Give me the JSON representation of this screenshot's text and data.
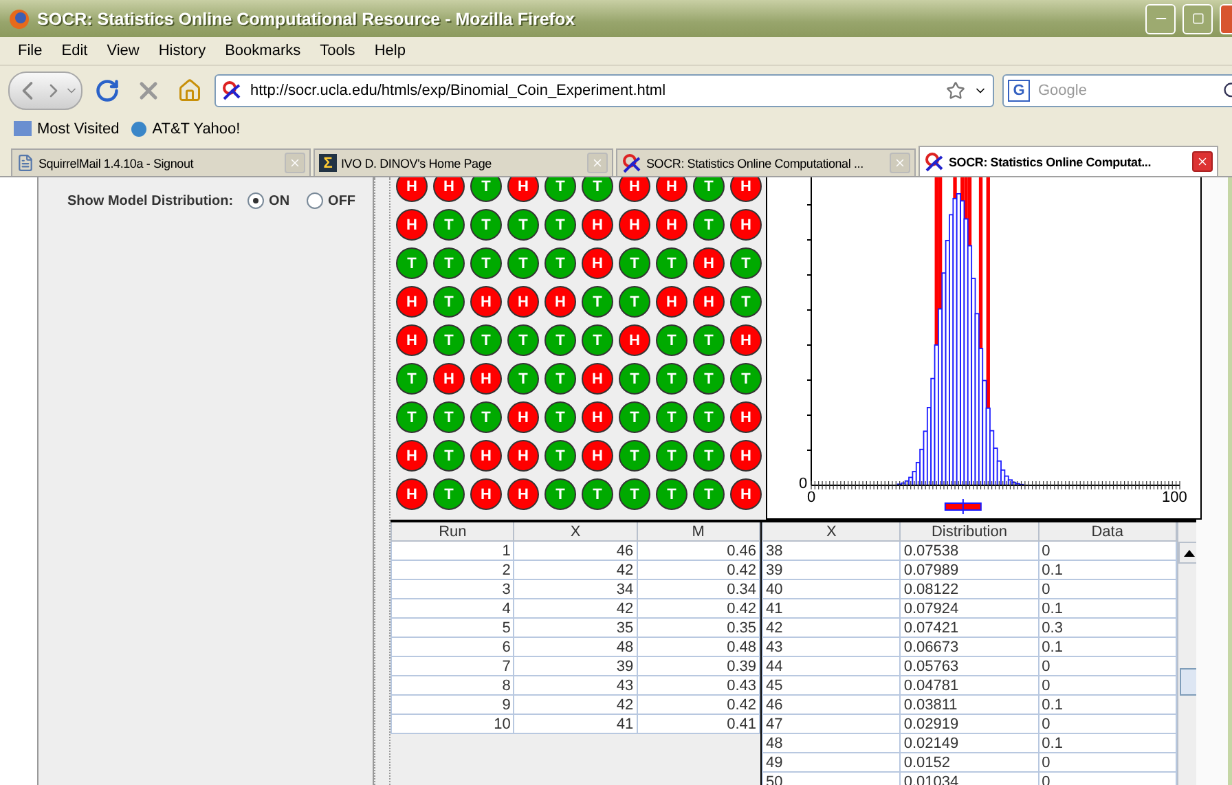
{
  "window": {
    "title": "SOCR: Statistics Online Computational Resource - Mozilla Firefox"
  },
  "menu": [
    "File",
    "Edit",
    "View",
    "History",
    "Bookmarks",
    "Tools",
    "Help"
  ],
  "address": {
    "value": "http://socr.ucla.edu/htmls/exp/Binomial_Coin_Experiment.html"
  },
  "search": {
    "engine": "G",
    "placeholder": "Google"
  },
  "bookmarks": [
    "Most Visited",
    "AT&T Yahoo!"
  ],
  "tabs": [
    {
      "label": "SquirrelMail 1.4.10a - Signout",
      "selected": false,
      "kind": "page"
    },
    {
      "label": "IVO D. DINOV's Home Page",
      "selected": false,
      "kind": "sigma",
      "icon": "Σ"
    },
    {
      "label": "SOCR: Statistics Online Computational ...",
      "selected": false,
      "kind": "socr"
    },
    {
      "label": "SOCR: Statistics Online Computat...",
      "selected": true,
      "kind": "socr"
    }
  ],
  "model_distribution": {
    "label": "Show Model Distribution:",
    "options": [
      {
        "label": "ON",
        "selected": true
      },
      {
        "label": "OFF",
        "selected": false
      }
    ]
  },
  "coins": [
    {
      "faces": [
        {
          "text": "H",
          "kind": "heads"
        },
        {
          "text": "H",
          "kind": "heads"
        },
        {
          "text": "T",
          "kind": "tails"
        },
        {
          "text": "H",
          "kind": "heads"
        },
        {
          "text": "T",
          "kind": "tails"
        },
        {
          "text": "T",
          "kind": "tails"
        },
        {
          "text": "H",
          "kind": "heads"
        },
        {
          "text": "H",
          "kind": "heads"
        },
        {
          "text": "T",
          "kind": "tails"
        },
        {
          "text": "H",
          "kind": "heads"
        }
      ]
    },
    {
      "faces": [
        {
          "text": "H",
          "kind": "heads"
        },
        {
          "text": "T",
          "kind": "tails"
        },
        {
          "text": "T",
          "kind": "tails"
        },
        {
          "text": "T",
          "kind": "tails"
        },
        {
          "text": "T",
          "kind": "tails"
        },
        {
          "text": "H",
          "kind": "heads"
        },
        {
          "text": "H",
          "kind": "heads"
        },
        {
          "text": "H",
          "kind": "heads"
        },
        {
          "text": "T",
          "kind": "tails"
        },
        {
          "text": "H",
          "kind": "heads"
        }
      ]
    },
    {
      "faces": [
        {
          "text": "T",
          "kind": "tails"
        },
        {
          "text": "T",
          "kind": "tails"
        },
        {
          "text": "T",
          "kind": "tails"
        },
        {
          "text": "T",
          "kind": "tails"
        },
        {
          "text": "T",
          "kind": "tails"
        },
        {
          "text": "H",
          "kind": "heads"
        },
        {
          "text": "T",
          "kind": "tails"
        },
        {
          "text": "T",
          "kind": "tails"
        },
        {
          "text": "H",
          "kind": "heads"
        },
        {
          "text": "T",
          "kind": "tails"
        }
      ]
    },
    {
      "faces": [
        {
          "text": "H",
          "kind": "heads"
        },
        {
          "text": "T",
          "kind": "tails"
        },
        {
          "text": "H",
          "kind": "heads"
        },
        {
          "text": "H",
          "kind": "heads"
        },
        {
          "text": "H",
          "kind": "heads"
        },
        {
          "text": "T",
          "kind": "tails"
        },
        {
          "text": "T",
          "kind": "tails"
        },
        {
          "text": "H",
          "kind": "heads"
        },
        {
          "text": "H",
          "kind": "heads"
        },
        {
          "text": "T",
          "kind": "tails"
        }
      ]
    },
    {
      "faces": [
        {
          "text": "H",
          "kind": "heads"
        },
        {
          "text": "T",
          "kind": "tails"
        },
        {
          "text": "T",
          "kind": "tails"
        },
        {
          "text": "T",
          "kind": "tails"
        },
        {
          "text": "T",
          "kind": "tails"
        },
        {
          "text": "T",
          "kind": "tails"
        },
        {
          "text": "H",
          "kind": "heads"
        },
        {
          "text": "T",
          "kind": "tails"
        },
        {
          "text": "T",
          "kind": "tails"
        },
        {
          "text": "H",
          "kind": "heads"
        }
      ]
    },
    {
      "faces": [
        {
          "text": "T",
          "kind": "tails"
        },
        {
          "text": "H",
          "kind": "heads"
        },
        {
          "text": "H",
          "kind": "heads"
        },
        {
          "text": "T",
          "kind": "tails"
        },
        {
          "text": "T",
          "kind": "tails"
        },
        {
          "text": "H",
          "kind": "heads"
        },
        {
          "text": "T",
          "kind": "tails"
        },
        {
          "text": "T",
          "kind": "tails"
        },
        {
          "text": "T",
          "kind": "tails"
        },
        {
          "text": "T",
          "kind": "tails"
        }
      ]
    },
    {
      "faces": [
        {
          "text": "T",
          "kind": "tails"
        },
        {
          "text": "T",
          "kind": "tails"
        },
        {
          "text": "T",
          "kind": "tails"
        },
        {
          "text": "H",
          "kind": "heads"
        },
        {
          "text": "T",
          "kind": "tails"
        },
        {
          "text": "H",
          "kind": "heads"
        },
        {
          "text": "T",
          "kind": "tails"
        },
        {
          "text": "T",
          "kind": "tails"
        },
        {
          "text": "T",
          "kind": "tails"
        },
        {
          "text": "H",
          "kind": "heads"
        }
      ]
    },
    {
      "faces": [
        {
          "text": "H",
          "kind": "heads"
        },
        {
          "text": "T",
          "kind": "tails"
        },
        {
          "text": "H",
          "kind": "heads"
        },
        {
          "text": "H",
          "kind": "heads"
        },
        {
          "text": "T",
          "kind": "tails"
        },
        {
          "text": "H",
          "kind": "heads"
        },
        {
          "text": "T",
          "kind": "tails"
        },
        {
          "text": "T",
          "kind": "tails"
        },
        {
          "text": "T",
          "kind": "tails"
        },
        {
          "text": "H",
          "kind": "heads"
        }
      ]
    },
    {
      "faces": [
        {
          "text": "H",
          "kind": "heads"
        },
        {
          "text": "T",
          "kind": "tails"
        },
        {
          "text": "H",
          "kind": "heads"
        },
        {
          "text": "H",
          "kind": "heads"
        },
        {
          "text": "T",
          "kind": "tails"
        },
        {
          "text": "T",
          "kind": "tails"
        },
        {
          "text": "T",
          "kind": "tails"
        },
        {
          "text": "T",
          "kind": "tails"
        },
        {
          "text": "T",
          "kind": "tails"
        },
        {
          "text": "H",
          "kind": "heads"
        }
      ]
    }
  ],
  "chart": {
    "y_label": "0",
    "x_labels": [
      "0",
      "100"
    ]
  },
  "runs_table": {
    "columns": [
      "Run",
      "X",
      "M"
    ],
    "rows": [
      [
        "1",
        "46",
        "0.46"
      ],
      [
        "2",
        "42",
        "0.42"
      ],
      [
        "3",
        "34",
        "0.34"
      ],
      [
        "4",
        "42",
        "0.42"
      ],
      [
        "5",
        "35",
        "0.35"
      ],
      [
        "6",
        "48",
        "0.48"
      ],
      [
        "7",
        "39",
        "0.39"
      ],
      [
        "8",
        "43",
        "0.43"
      ],
      [
        "9",
        "42",
        "0.42"
      ],
      [
        "10",
        "41",
        "0.41"
      ]
    ]
  },
  "distribution_table": {
    "columns": [
      "X",
      "Distribution",
      "Data"
    ],
    "rows": [
      [
        "38",
        "0.07538",
        "0"
      ],
      [
        "39",
        "0.07989",
        "0.1"
      ],
      [
        "40",
        "0.08122",
        "0"
      ],
      [
        "41",
        "0.07924",
        "0.1"
      ],
      [
        "42",
        "0.07421",
        "0.3"
      ],
      [
        "43",
        "0.06673",
        "0.1"
      ],
      [
        "44",
        "0.05763",
        "0"
      ],
      [
        "45",
        "0.04781",
        "0"
      ],
      [
        "46",
        "0.03811",
        "0.1"
      ],
      [
        "47",
        "0.02919",
        "0"
      ],
      [
        "48",
        "0.02149",
        "0.1"
      ],
      [
        "49",
        "0.0152",
        "0"
      ],
      [
        "50",
        "0.01034",
        "0"
      ]
    ]
  }
}
